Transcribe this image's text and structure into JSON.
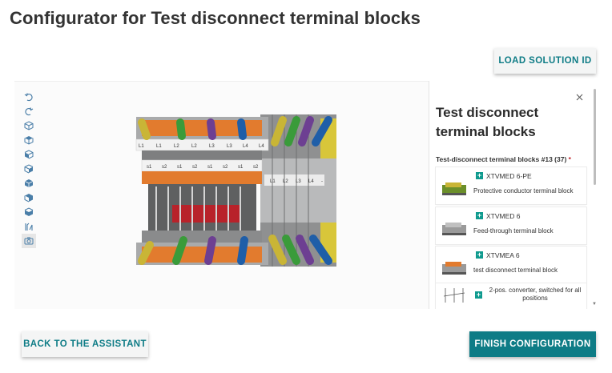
{
  "page": {
    "title": "Configurator for Test disconnect terminal blocks"
  },
  "actions": {
    "load_solution_id": "LOAD SOLUTION ID",
    "back_to_assistant": "BACK TO THE ASSISTANT",
    "finish_configuration": "FINISH CONFIGURATION"
  },
  "toolbar": {
    "tools": [
      "undo-icon",
      "redo-icon",
      "cube-view-icon",
      "cube-top-icon",
      "cube-front-icon",
      "cube-side-icon",
      "cube-iso-icon",
      "cube-back-icon",
      "cube-bottom-icon",
      "dimension-icon",
      "screenshot-icon"
    ]
  },
  "model": {
    "labels_top": [
      "L1",
      "L1",
      "L2",
      "L2",
      "L3",
      "L3",
      "L4",
      "L4"
    ],
    "labels_mid": [
      "s1",
      "s2",
      "s1",
      "s2",
      "s1",
      "s2",
      "s1",
      "s2"
    ],
    "labels_right": [
      "L1",
      "L2",
      "L3",
      "L4",
      "-"
    ],
    "wire_colors": {
      "grey": "#9a9a9a",
      "green": "#3a9b3a",
      "purple": "#6d3f92",
      "blue": "#1f5ea8",
      "yellow": "#c9b536",
      "orange": "#e07a2b",
      "red": "#b8222a"
    }
  },
  "panel": {
    "title": "Test disconnect terminal blocks",
    "section_label": "Test-disconnect terminal blocks #13 (37)",
    "required_mark": "*",
    "options": [
      {
        "code": "XTVMED 6-PE",
        "description": "Protective conductor terminal block"
      },
      {
        "code": "XTVMED 6",
        "description": "Feed-through terminal block"
      },
      {
        "code": "XTVMEA 6",
        "description": "test disconnect terminal block"
      },
      {
        "code": "",
        "description": "2-pos. converter, switched for all positions"
      }
    ]
  }
}
